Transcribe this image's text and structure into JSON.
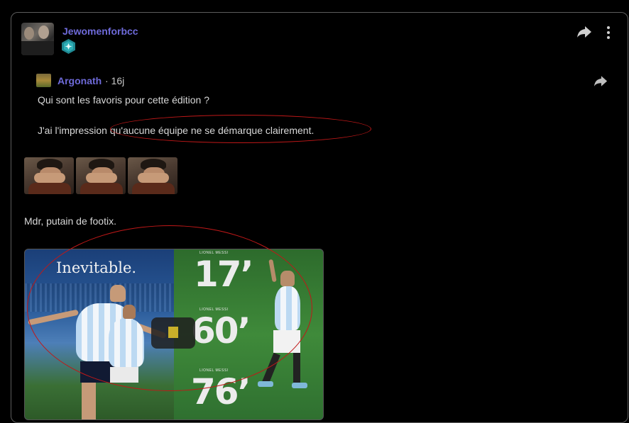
{
  "post": {
    "author": "Jewomenforbcc",
    "badge_icon": "diamond-badge-icon",
    "actions": {
      "share_icon": "share-icon",
      "more_icon": "more-vertical-icon"
    }
  },
  "quote": {
    "author": "Argonath",
    "time": "· 16j",
    "share_icon": "share-icon",
    "line1": "Qui sont les favoris pour cette édition ?",
    "line2": "J'ai l'impression qu'aucune équipe ne se démarque clairement."
  },
  "emotes": [
    "facepalm-emote",
    "facepalm-emote",
    "facepalm-emote"
  ],
  "body": {
    "text": "Mdr, putain de footix."
  },
  "media": {
    "caption": "Inevitable.",
    "right_labels": [
      "LIONEL MESSI",
      "LIONEL MESSI",
      "LIONEL MESSI"
    ],
    "minutes": [
      "17’",
      "60’",
      "76’"
    ],
    "play_icon": "play-icon"
  },
  "colors": {
    "background": "#000000",
    "username": "#6e6ad9",
    "text": "#d8d8d8",
    "annotation": "#c01818"
  }
}
